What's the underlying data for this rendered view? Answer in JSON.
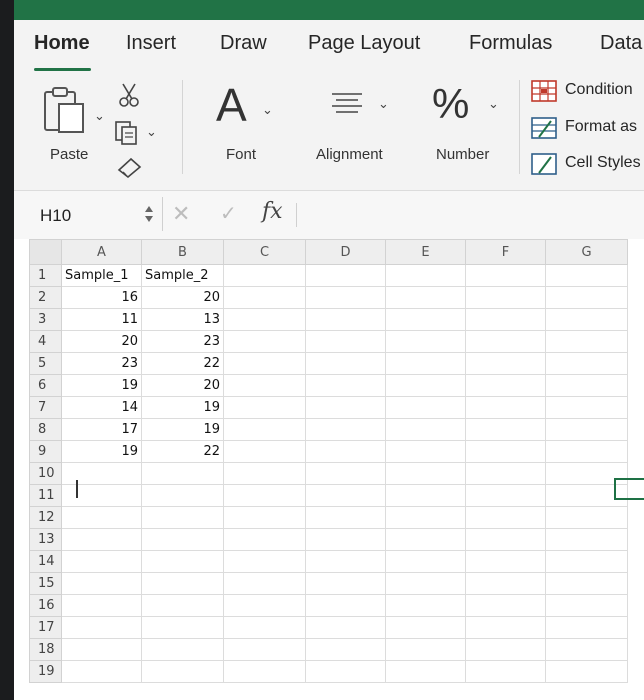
{
  "tabs": [
    "Home",
    "Insert",
    "Draw",
    "Page Layout",
    "Formulas",
    "Data"
  ],
  "ribbon": {
    "paste_label": "Paste",
    "font_label": "Font",
    "font_glyph": "A",
    "alignment_label": "Alignment",
    "number_label": "Number",
    "number_glyph": "%",
    "conditional_label": "Condition",
    "format_as_label": "Format as",
    "cell_styles_label": "Cell Styles"
  },
  "formula_bar": {
    "name_box": "H10",
    "fx": "fx",
    "value": ""
  },
  "sheet": {
    "selected_cell": "H10",
    "columns": [
      "A",
      "B",
      "C",
      "D",
      "E",
      "F",
      "G"
    ],
    "rows": [
      [
        "Sample_1",
        "Sample_2"
      ],
      [
        "16",
        "20"
      ],
      [
        "11",
        "13"
      ],
      [
        "20",
        "23"
      ],
      [
        "23",
        "22"
      ],
      [
        "19",
        "20"
      ],
      [
        "14",
        "19"
      ],
      [
        "17",
        "19"
      ],
      [
        "19",
        "22"
      ],
      [],
      [],
      [],
      [],
      [],
      [],
      [],
      [],
      [],
      []
    ]
  },
  "colors": {
    "accent": "#217346",
    "selection": "#1e7145"
  }
}
